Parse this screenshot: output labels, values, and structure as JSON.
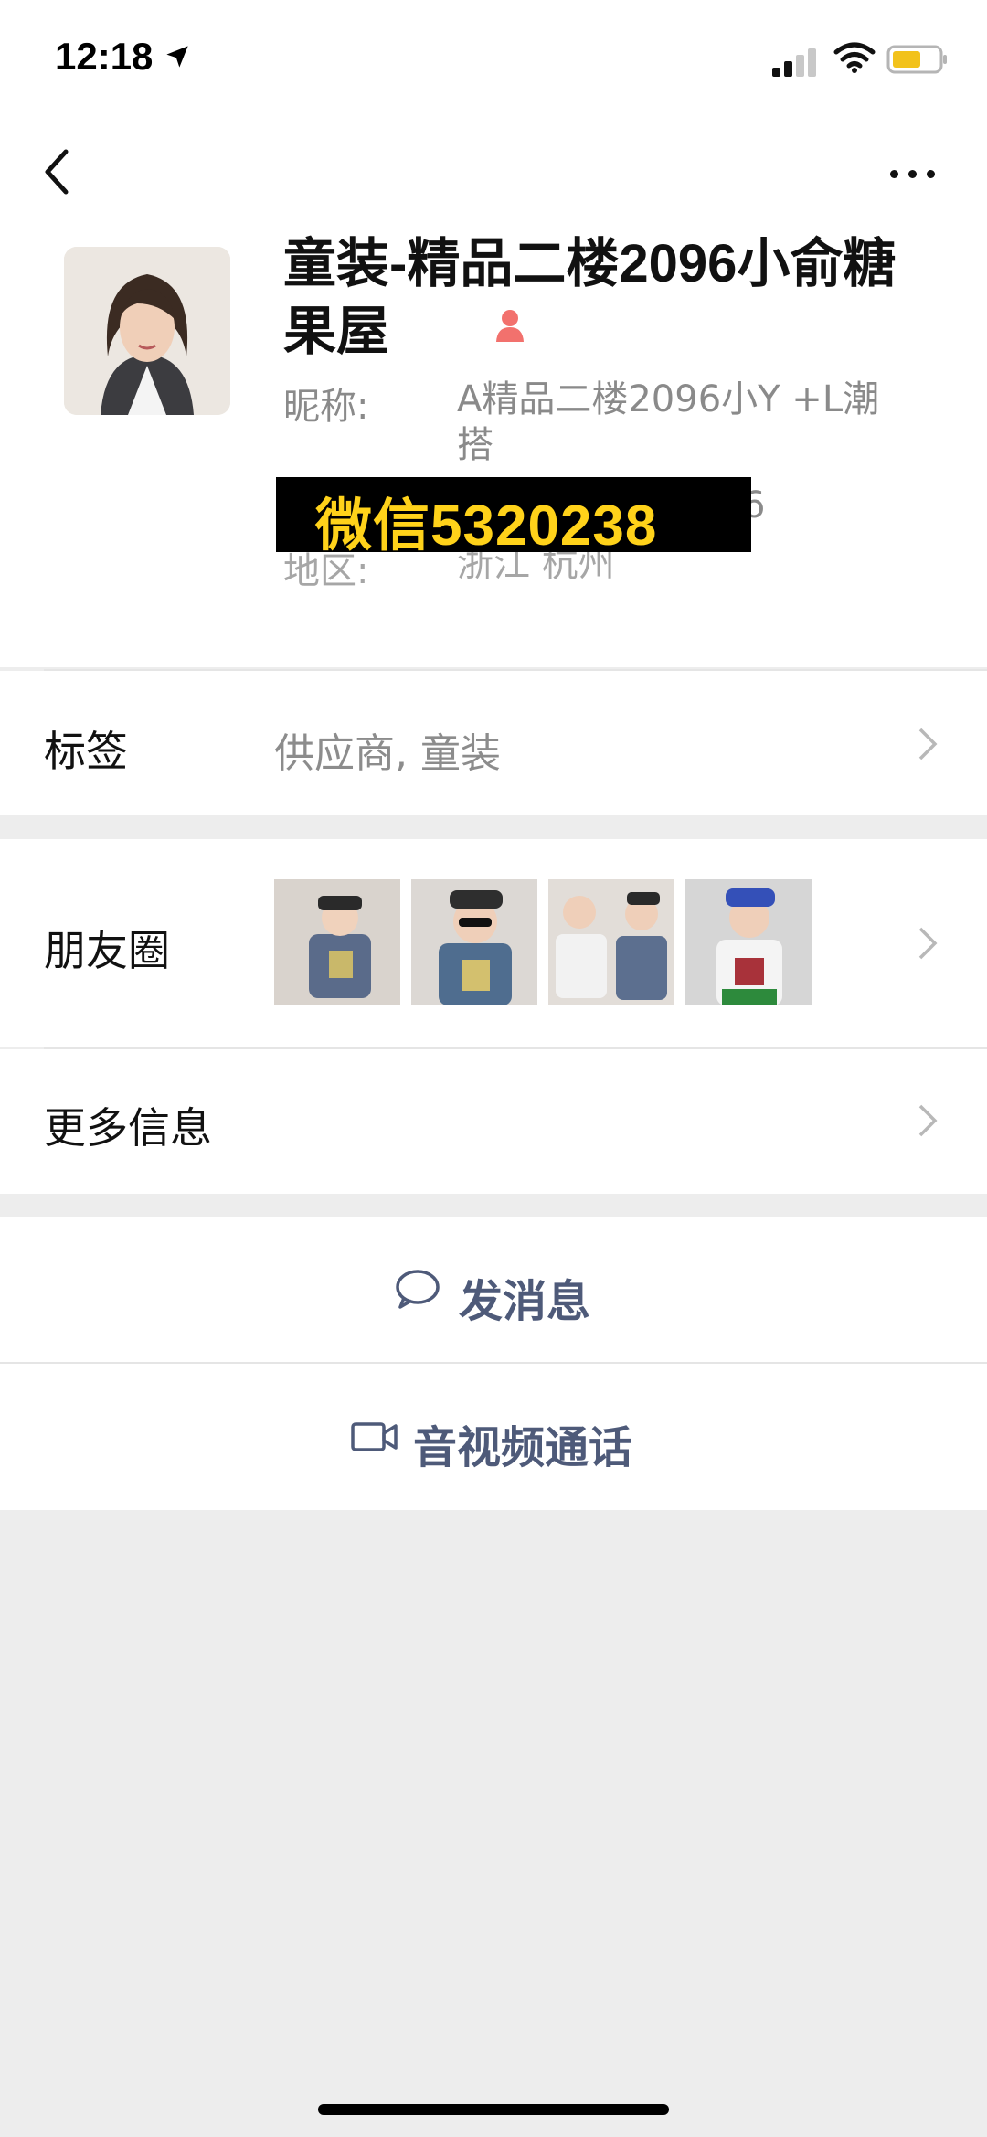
{
  "status_bar": {
    "time": "12:18"
  },
  "profile": {
    "name": "童装-精品二楼2096小俞糖果屋",
    "nickname_label": "昵称:",
    "nickname_value": "A精品二楼2096小Y +L潮搭",
    "id_tail": "6",
    "region_label": "地区:",
    "region_value": "浙江 杭州"
  },
  "overlay": {
    "text": "微信5320238"
  },
  "rows": {
    "tags_label": "标签",
    "tags_value": "供应商, 童装",
    "moments_label": "朋友圈",
    "more_label": "更多信息"
  },
  "actions": {
    "message_label": "发消息",
    "call_label": "音视频通话"
  },
  "colors": {
    "action_text": "#4e5a79",
    "overlay_bg": "#000000",
    "overlay_text": "#ffd21a",
    "background": "#ededed"
  }
}
